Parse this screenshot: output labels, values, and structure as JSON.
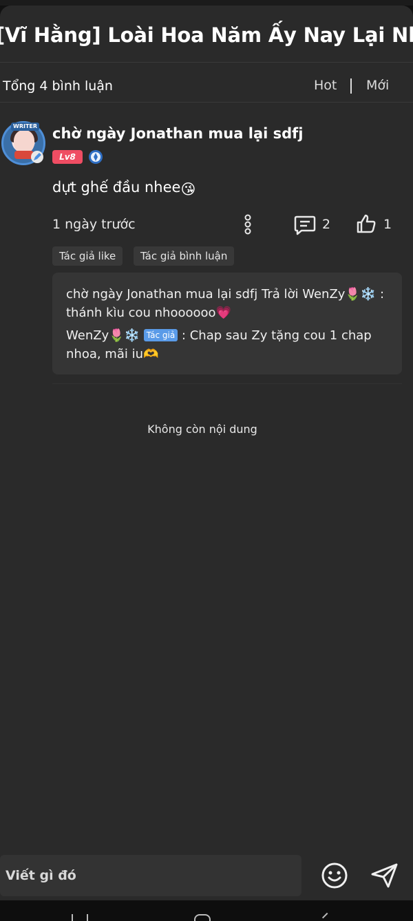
{
  "header": {
    "title": "[Vĩ Hằng] Loài Hoa Năm Ấy Nay Lại Nhỏ Máu"
  },
  "filter": {
    "total": "Tổng 4 bình luận",
    "sort_hot": "Hot",
    "sort_new": "Mới"
  },
  "comment": {
    "avatar_badge": "WRITER",
    "username": "chờ ngày Jonathan mua lại sdfj",
    "level": "Lv8",
    "text": "dựt ghế đầu nhee",
    "text_emoji": "😘",
    "time": "1 ngày trước",
    "reply_count": "2",
    "like_count": "1",
    "tags": [
      "Tác giả like",
      "Tác giả bình luận"
    ],
    "replies": [
      {
        "text": "chờ ngày Jonathan mua lại sdfj Trả lời WenZy🌷❄️ : thánh kìu cou nhoooooo💗"
      },
      {
        "author": "WenZy🌷❄️",
        "badge": "Tác giả",
        "text": " : Chap sau Zy tặng cou 1 chap nhoa, mãi iu🫶"
      }
    ]
  },
  "end_message": "Không còn nội dung",
  "composer": {
    "placeholder": "Viết gì đó"
  },
  "colors": {
    "background": "#2a2a2a",
    "level_badge": "#ef4d63",
    "author_badge": "#5a9be8",
    "verified": "#4a8fe0"
  },
  "icons": [
    "more-vertical-icon",
    "reply-icon",
    "like-icon",
    "emoji-icon",
    "send-icon",
    "verified-icon"
  ]
}
